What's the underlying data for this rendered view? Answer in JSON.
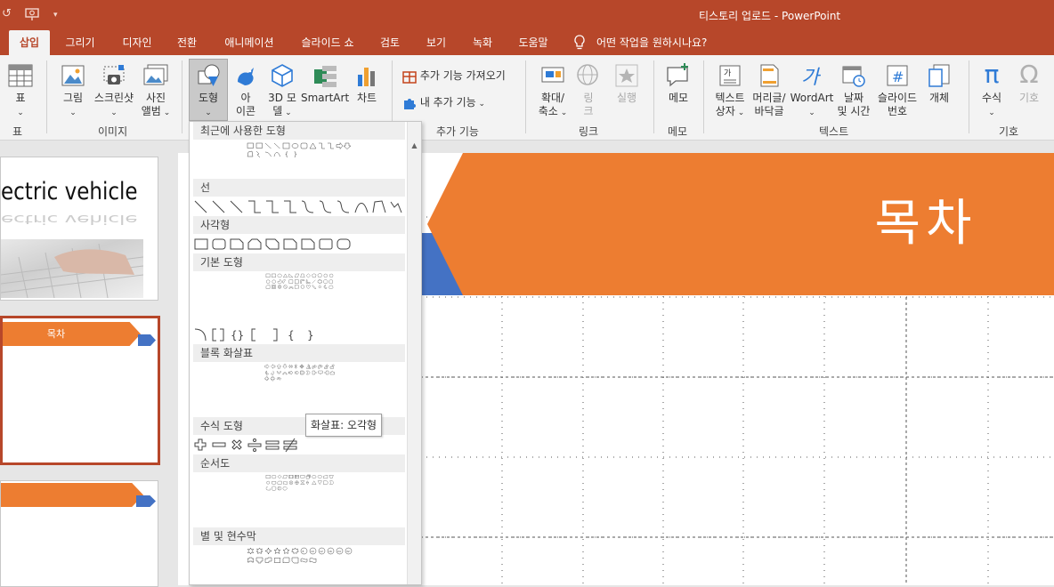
{
  "window": {
    "title": "티스토리 업로드 - PowerPoint"
  },
  "quick_access": {
    "undo_icon": "undo-icon",
    "presenter_icon": "presenter-view-icon",
    "customize_icon": "chevron-down-icon"
  },
  "tabs": [
    "삽입",
    "그리기",
    "디자인",
    "전환",
    "애니메이션",
    "슬라이드 쇼",
    "검토",
    "보기",
    "녹화",
    "도움말"
  ],
  "active_tab": "삽입",
  "tell_me": "어떤 작업을 원하시나요?",
  "ribbon": {
    "table": {
      "label": "표",
      "group": "표"
    },
    "images": {
      "group": "이미지",
      "picture": "그림",
      "screenshot": "스크린샷",
      "album_1": "사진",
      "album_2": "앨범"
    },
    "illustrations": {
      "shapes": "도형",
      "icons_1": "아",
      "icons_2": "이콘",
      "model_1": "3D 모",
      "model_2": "델",
      "smartart": "SmartArt",
      "chart": "차트"
    },
    "addins": {
      "get": "추가 기능 가져오기",
      "my": "내 추가 기능",
      "group": "추가 기능"
    },
    "links": {
      "zoom_1": "확대/",
      "zoom_2": "축소",
      "link_1": "링",
      "link_2": "크",
      "action": "실행",
      "group": "링크"
    },
    "comments": {
      "comment": "메모",
      "group": "메모"
    },
    "text": {
      "textbox_1": "텍스트",
      "textbox_2": "상자",
      "header_1": "머리글/",
      "header_2": "바닥글",
      "wordart": "WordArt",
      "date_1": "날짜",
      "date_2": "및 시간",
      "slidenum_1": "슬라이드",
      "slidenum_2": "번호",
      "object": "개체",
      "group": "텍스트"
    },
    "symbols": {
      "equation": "수식",
      "symbol": "기호",
      "group": "기호"
    }
  },
  "thumbnails": {
    "slide1_text": "ectric vehicle",
    "slide1_reflect": "ectric vehicle",
    "slide2_title": "목차"
  },
  "slide": {
    "title": "목차",
    "accent_orange": "#ed7d31",
    "accent_blue": "#4472c4"
  },
  "shapes_menu": {
    "sections": [
      "최근에 사용한 도형",
      "선",
      "사각형",
      "기본 도형",
      "블록 화살표",
      "수식 도형",
      "순서도",
      "별 및 현수막"
    ]
  },
  "tooltip": "화살표: 오각형",
  "colors": {
    "brand": "#b7472a",
    "ribbon": "#f3f3f3"
  }
}
